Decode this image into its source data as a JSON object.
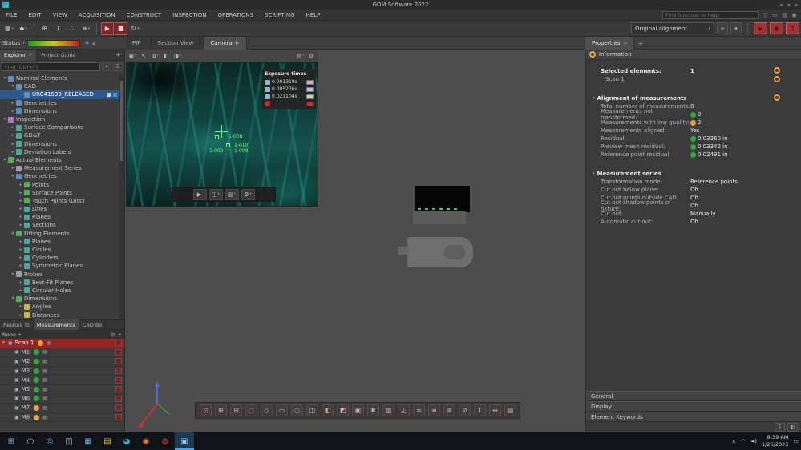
{
  "ui": {
    "close": "✕",
    "caret": "▾",
    "plus": "+",
    "gear": "⚙",
    "menu": "☰",
    "camera_glyph": "▣",
    "mesh_glyph": "▦"
  },
  "colors": {
    "accent_orange": "#e8a33d",
    "status_green": "#2fa83a",
    "alert_red": "#a03434",
    "selection_blue": "#2d5a8e",
    "selection_red": "#962525"
  },
  "titlebar": {
    "title": "GOM Software 2022"
  },
  "menubar": {
    "items": [
      "FILE",
      "EDIT",
      "VIEW",
      "ACQUISITION",
      "CONSTRUCT",
      "INSPECTION",
      "OPERATIONS",
      "SCRIPTING",
      "HELP"
    ],
    "search_placeholder": "Find function or help",
    "icons": [
      {
        "name": "filter-icon",
        "glyph": "▽"
      },
      {
        "name": "display-icon",
        "glyph": "▭"
      },
      {
        "name": "printer-icon",
        "glyph": "▤"
      },
      {
        "name": "notifications-icon",
        "glyph": "◉"
      }
    ]
  },
  "toolbar": {
    "group1": [
      {
        "name": "window-layout-button",
        "glyph": "▦",
        "caret": "▾"
      },
      {
        "name": "probe-button",
        "glyph": "◆",
        "caret": "▾"
      }
    ],
    "group2": [
      {
        "name": "new-element-button",
        "glyph": "⊕"
      },
      {
        "name": "label-button",
        "glyph": "T"
      },
      {
        "name": "point-cloud-button",
        "glyph": "∴"
      },
      {
        "name": "stage-button",
        "glyph": "≡",
        "caret": "▾"
      }
    ],
    "group3": [
      {
        "name": "scan-start-button",
        "glyph": "▶",
        "cls": "active"
      },
      {
        "name": "scan-stop-button",
        "glyph": "■",
        "cls": "active"
      },
      {
        "name": "refresh-button",
        "glyph": "↻",
        "caret": "▾"
      }
    ],
    "alignment_label": "Original alignment",
    "red_buttons": [
      {
        "name": "acquisition-start-button",
        "glyph": "▶"
      },
      {
        "name": "acquisition-snapshot-button",
        "glyph": "◉"
      },
      {
        "name": "acquisition-export-button",
        "glyph": "↥"
      }
    ]
  },
  "statusbar": {
    "label": "Status"
  },
  "viewport_tabs": [
    {
      "label": "PIP"
    },
    {
      "label": "Section View"
    },
    {
      "label": "Camera",
      "cls": "active",
      "close": "✕"
    }
  ],
  "properties_tab": {
    "label": "Properties"
  },
  "explorer": {
    "tabs_active": "Explorer",
    "tabs_inactive": "Project Guide",
    "search_placeholder": "Find (Ctrl+F)",
    "tree": [
      {
        "label": "Nominal Elements",
        "lvl": "lvl0",
        "st": "open",
        "ic": "ic-blue"
      },
      {
        "label": "CAD",
        "lvl": "lvl1",
        "st": "open",
        "ic": "ic-blue"
      },
      {
        "label": "URC41539_RELEASED",
        "lvl": "lvl2",
        "st": "leaf",
        "ic": "ic-blue",
        "sel": "selected"
      },
      {
        "label": "Geometries",
        "lvl": "lvl1",
        "st": "closed",
        "ic": "ic-blue"
      },
      {
        "label": "Dimensions",
        "lvl": "lvl1",
        "st": "closed",
        "ic": "ic-blue"
      },
      {
        "label": "Inspection",
        "lvl": "lvl0",
        "st": "open",
        "ic": "ic-purple"
      },
      {
        "label": "Surface Comparisons",
        "lvl": "lvl1",
        "st": "closed",
        "ic": "ic-teal"
      },
      {
        "label": "GD&T",
        "lvl": "lvl1",
        "st": "closed",
        "ic": "ic-teal"
      },
      {
        "label": "Dimensions",
        "lvl": "lvl1",
        "st": "closed",
        "ic": "ic-teal"
      },
      {
        "label": "Deviation Labels",
        "lvl": "lvl1",
        "st": "closed",
        "ic": "ic-teal"
      },
      {
        "label": "Actual Elements",
        "lvl": "lvl0",
        "st": "open",
        "ic": "ic-green"
      },
      {
        "label": "Measurement Series",
        "lvl": "lvl1",
        "st": "closed",
        "ic": "ic-gray"
      },
      {
        "label": "Geometries",
        "lvl": "lvl1",
        "st": "open",
        "ic": "ic-blue"
      },
      {
        "label": "Points",
        "lvl": "lvl2",
        "st": "closed",
        "ic": "ic-green"
      },
      {
        "label": "Surface Points",
        "lvl": "lvl2",
        "st": "closed",
        "ic": "ic-green"
      },
      {
        "label": "Touch Points (Disc)",
        "lvl": "lvl2",
        "st": "closed",
        "ic": "ic-green"
      },
      {
        "label": "Lines",
        "lvl": "lvl2",
        "st": "closed",
        "ic": "ic-teal"
      },
      {
        "label": "Planes",
        "lvl": "lvl2",
        "st": "closed",
        "ic": "ic-teal"
      },
      {
        "label": "Sections",
        "lvl": "lvl2",
        "st": "closed",
        "ic": "ic-teal"
      },
      {
        "label": "Fitting Elements",
        "lvl": "lvl1",
        "st": "open",
        "ic": "ic-green"
      },
      {
        "label": "Planes",
        "lvl": "lvl2",
        "st": "closed",
        "ic": "ic-teal"
      },
      {
        "label": "Circles",
        "lvl": "lvl2",
        "st": "closed",
        "ic": "ic-teal"
      },
      {
        "label": "Cylinders",
        "lvl": "lvl2",
        "st": "closed",
        "ic": "ic-teal"
      },
      {
        "label": "Symmetric Planes",
        "lvl": "lvl2",
        "st": "closed",
        "ic": "ic-teal"
      },
      {
        "label": "Probes",
        "lvl": "lvl1",
        "st": "open",
        "ic": "ic-gray"
      },
      {
        "label": "Best-Fit Planes",
        "lvl": "lvl2",
        "st": "closed",
        "ic": "ic-teal"
      },
      {
        "label": "Circular Holes",
        "lvl": "lvl2",
        "st": "closed",
        "ic": "ic-teal"
      },
      {
        "label": "Dimensions",
        "lvl": "lvl1",
        "st": "open",
        "ic": "ic-green"
      },
      {
        "label": "Angles",
        "lvl": "lvl2",
        "st": "closed",
        "ic": "ic-yellow"
      },
      {
        "label": "Distances",
        "lvl": "lvl2",
        "st": "closed",
        "ic": "ic-yellow"
      }
    ]
  },
  "measurements": {
    "tabs": [
      {
        "label": "Relates To"
      },
      {
        "label": "Measurements",
        "cls": "active"
      },
      {
        "label": "CAD Bo"
      }
    ],
    "header": "None",
    "rows": [
      {
        "label": "Scan 1",
        "status": "warn",
        "sel": "selected",
        "exp": "▾"
      },
      {
        "label": "M1",
        "status": "ok",
        "ind": "ind"
      },
      {
        "label": "M2",
        "status": "ok",
        "ind": "ind"
      },
      {
        "label": "M3",
        "status": "ok",
        "ind": "ind"
      },
      {
        "label": "M4",
        "status": "ok",
        "ind": "ind"
      },
      {
        "label": "M5",
        "status": "ok",
        "ind": "ind"
      },
      {
        "label": "M6",
        "status": "ok",
        "ind": "ind"
      },
      {
        "label": "M7",
        "status": "warn",
        "ind": "ind"
      },
      {
        "label": "M8",
        "status": "warn",
        "ind": "ind"
      }
    ]
  },
  "vp_toolbar": {
    "left": [
      {
        "name": "view-mode-button",
        "glyph": "▣",
        "caret": "▾"
      },
      {
        "name": "cursor-button",
        "glyph": "↖"
      },
      {
        "name": "selection-mode-button",
        "glyph": "⊞",
        "caret": "▾"
      },
      {
        "name": "clipping-button",
        "glyph": "◧"
      },
      {
        "name": "shading-button",
        "glyph": "◑",
        "caret": "▾"
      }
    ],
    "right": [
      {
        "name": "camera-view-button",
        "glyph": "▤",
        "caret": "▾"
      },
      {
        "name": "viewport-settings-button",
        "glyph": "⚙"
      }
    ]
  },
  "camera": {
    "exposure_title": "Exposure times",
    "exposures": [
      {
        "value": "0.001319s",
        "swatch": "#ccb6c0"
      },
      {
        "value": "0.005276s",
        "swatch": "#c2bcdc"
      },
      {
        "value": "0.021104s",
        "swatch": "#c6d8ba"
      }
    ],
    "current_swatch": "#d02828",
    "point_labels": [
      "1-008",
      "1-010",
      "1-002",
      "1-009"
    ],
    "bar_buttons": [
      {
        "name": "measure-play-button",
        "glyph": "▶"
      },
      {
        "name": "preview-3d-button",
        "glyph": "◫",
        "caret": "▾"
      },
      {
        "name": "histogram-button",
        "glyph": "▥",
        "caret": "▾"
      },
      {
        "name": "exposure-settings-button",
        "glyph": "⚙",
        "caret": "▾"
      }
    ]
  },
  "bottom_strip": [
    {
      "name": "select-points-icon",
      "glyph": "⊡"
    },
    {
      "name": "select-area-icon",
      "glyph": "⊞"
    },
    {
      "name": "deselect-icon",
      "glyph": "⊟"
    },
    {
      "name": "lasso-select-icon",
      "glyph": "◌"
    },
    {
      "name": "polygon-select-icon",
      "glyph": "◇"
    },
    {
      "name": "rectangle-select-icon",
      "glyph": "▭"
    },
    {
      "name": "circle-select-icon",
      "glyph": "○"
    },
    {
      "name": "through-surface-select-icon",
      "glyph": "◫"
    },
    {
      "name": "on-surface-select-icon",
      "glyph": "◧"
    },
    {
      "name": "invert-selection-icon",
      "glyph": "◩"
    },
    {
      "name": "select-all-icon",
      "glyph": "▣"
    },
    {
      "name": "clear-selection-icon",
      "glyph": "✖"
    },
    {
      "name": "mesh-tool-icon",
      "glyph": "▧"
    },
    {
      "name": "fill-holes-icon",
      "glyph": "◬"
    },
    {
      "name": "smooth-mesh-icon",
      "glyph": "≈"
    },
    {
      "name": "thin-mesh-icon",
      "glyph": "≡"
    },
    {
      "name": "refine-mesh-icon",
      "glyph": "⊛"
    },
    {
      "name": "section-tool-icon",
      "glyph": "⊘"
    },
    {
      "name": "label-tool-icon",
      "glyph": "T"
    },
    {
      "name": "measure-tool-icon",
      "glyph": "↔"
    },
    {
      "name": "snapshot-tool-icon",
      "glyph": "▤"
    }
  ],
  "properties": {
    "info_title": "Information",
    "selected_label": "Selected elements:",
    "selected_value": "1",
    "selected_item": "Scan 1",
    "alignment_title": "Alignment of measurements",
    "alignment_rows": [
      {
        "label": "Total number of measurements:",
        "value": "8",
        "icon": "none"
      },
      {
        "label": "Measurements not transformed:",
        "value": "0",
        "icon": "green"
      },
      {
        "label": "Measurements with low quality:",
        "value": "2",
        "icon": "orange"
      },
      {
        "label": "Measurements aligned:",
        "value": "Yes",
        "icon": "none"
      },
      {
        "label": "Residual:",
        "value": "0.03360 in",
        "icon": "green"
      },
      {
        "label": "Preview mesh residual:",
        "value": "0.03342 in",
        "icon": "green"
      },
      {
        "label": "Reference point residual:",
        "value": "0.02491 in",
        "icon": "green"
      }
    ],
    "series_title": "Measurement series",
    "series_rows": [
      {
        "label": "Transformation mode:",
        "value": "Reference points",
        "icon": "none"
      },
      {
        "label": "Cut out below plane:",
        "value": "Off",
        "icon": "none"
      },
      {
        "label": "Cut out points outside CAD:",
        "value": "Off",
        "icon": "none"
      },
      {
        "label": "Cut out shadow points of fixture:",
        "value": "Off",
        "icon": "none"
      },
      {
        "label": "Cut out:",
        "value": "Manually",
        "icon": "none"
      },
      {
        "label": "Automatic cut out:",
        "value": "Off",
        "icon": "none"
      }
    ],
    "bottom_sections": [
      "General",
      "Display",
      "Element Keywords"
    ]
  },
  "taskbar": {
    "icons": [
      {
        "name": "start-button",
        "glyph": "⊞",
        "color": "#7ab8e8"
      },
      {
        "name": "search-button",
        "glyph": "○",
        "color": "#c8c8c8"
      },
      {
        "name": "cortana-button",
        "glyph": "◎",
        "color": "#58b8d8"
      },
      {
        "name": "task-view-button",
        "glyph": "◫",
        "color": "#c8c8c8"
      },
      {
        "name": "widgets-button",
        "glyph": "▦",
        "color": "#6ab0e0"
      },
      {
        "name": "file-explorer-button",
        "glyph": "▤",
        "color": "#e8c050"
      },
      {
        "name": "edge-button",
        "glyph": "◕",
        "color": "#38a8c8"
      },
      {
        "name": "firefox-button",
        "glyph": "◉",
        "color": "#e87828"
      },
      {
        "name": "browser-button",
        "glyph": "◍",
        "color": "#d04838"
      },
      {
        "name": "gom-app-button",
        "glyph": "▣",
        "color": "#8ac4f0",
        "cls": "active"
      }
    ],
    "tray": [
      {
        "name": "tray-chevron-icon",
        "glyph": "∧"
      },
      {
        "name": "network-icon",
        "glyph": "◠"
      },
      {
        "name": "volume-icon",
        "glyph": "◄)"
      }
    ],
    "time": "8:39 AM",
    "date": "1/26/2023",
    "notification_glyph": "▭"
  }
}
